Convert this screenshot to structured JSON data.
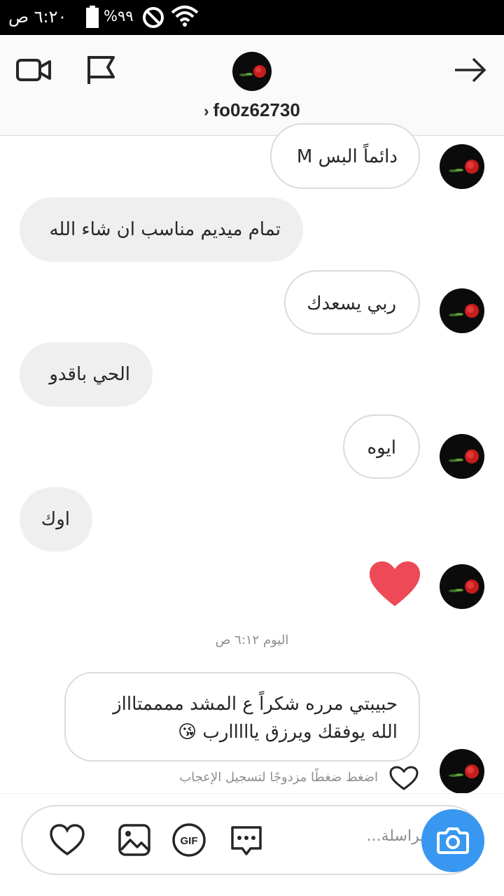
{
  "status_bar": {
    "time": "٦:٢٠ ص",
    "battery_percent": "%٩٩"
  },
  "header": {
    "username": "fo0z62730",
    "chevron": "›"
  },
  "messages": [
    {
      "text": "دائماً البس M",
      "direction": "incoming"
    },
    {
      "text": "تمام ميديم مناسب ان شاء الله",
      "direction": "outgoing"
    },
    {
      "text": "ربي يسعدك",
      "direction": "incoming"
    },
    {
      "text": "الحي باقدو",
      "direction": "outgoing"
    },
    {
      "text": "ايوه",
      "direction": "incoming"
    },
    {
      "text": "اوك",
      "direction": "outgoing"
    },
    {
      "text": "❤",
      "direction": "incoming",
      "type": "heart"
    },
    {
      "line1": "حبيبتي مرره شكراً ع المشد ممممتاااز",
      "line2": "الله يوفقك ويرزق يااااارب 😘",
      "direction": "incoming"
    }
  ],
  "timestamp": "اليوم ٦:١٢ ص",
  "like_hint": "اضغط ضغطًا مزدوجًا لتسجيل الإعجاب",
  "composer": {
    "placeholder": "مراسلة..."
  },
  "colors": {
    "accent": "#3897f0",
    "heart": "#ed4956",
    "bubble_out": "#efefef",
    "border": "#dbdbdb"
  },
  "icons": [
    "video-call-icon",
    "flag-icon",
    "back-arrow-icon",
    "heart-icon",
    "gallery-icon",
    "gif-icon",
    "sticker-icon",
    "camera-icon"
  ]
}
